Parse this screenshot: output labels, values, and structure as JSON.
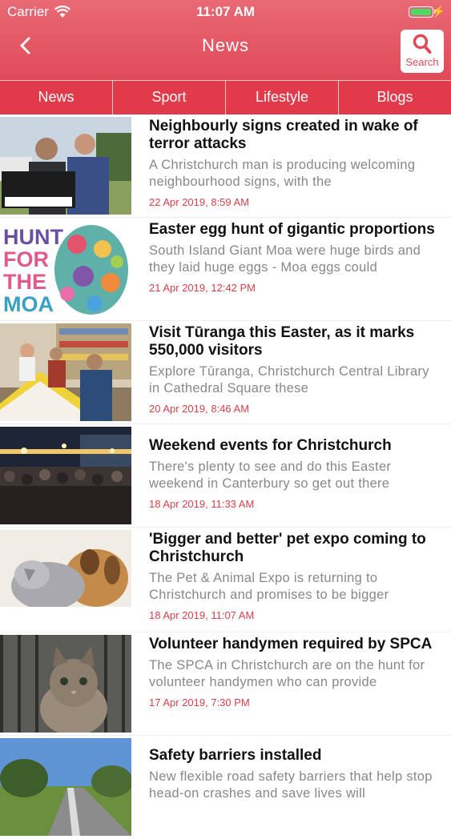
{
  "status": {
    "carrier": "Carrier",
    "time": "11:07 AM"
  },
  "nav": {
    "title": "News",
    "search_label": "Search"
  },
  "tabs": [
    {
      "label": "News"
    },
    {
      "label": "Sport"
    },
    {
      "label": "Lifestyle"
    },
    {
      "label": "Blogs"
    }
  ],
  "articles": [
    {
      "headline": "Neighbourly signs created in wake of terror attacks",
      "summary": "A Christchurch man is producing welcoming neighbourhood signs, with the",
      "date": "22 Apr 2019, 8:59 AM",
      "image": "two-men-holding-sign"
    },
    {
      "headline": "Easter egg hunt of gigantic proportions",
      "summary": "South Island Giant Moa were huge birds and they laid huge eggs - Moa eggs could",
      "date": "21 Apr 2019, 12:42 PM",
      "image": "hunt-for-the-moa-egg",
      "image_text": [
        "HUNT",
        "FOR",
        "THE",
        "MOA"
      ]
    },
    {
      "headline": "Visit Tūranga this Easter, as it marks 550,000 visitors",
      "summary": "Explore Tūranga, Christchurch Central Library in Cathedral Square these",
      "date": "20 Apr 2019, 8:46 AM",
      "image": "library-visitors"
    },
    {
      "headline": "Weekend events for Christchurch",
      "summary": "There's plenty to see and do this Easter weekend in Canterbury so get out there",
      "date": "18 Apr 2019, 11:33 AM",
      "image": "night-crowd"
    },
    {
      "headline": "'Bigger and better' pet expo coming to Christchurch",
      "summary": "The Pet & Animal Expo is returning to Christchurch and promises to be bigger",
      "date": "18 Apr 2019, 11:07 AM",
      "image": "kitten-and-puppy"
    },
    {
      "headline": "Volunteer handymen required by SPCA",
      "summary": "The SPCA in Christchurch are on the hunt for volunteer handymen who can provide",
      "date": "17 Apr 2019, 7:30 PM",
      "image": "kitten-in-cage"
    },
    {
      "headline": "Safety barriers installed",
      "summary": "New flexible road safety barriers that help stop head-on crashes and save lives will",
      "date": "",
      "image": "road-with-barriers"
    }
  ]
}
